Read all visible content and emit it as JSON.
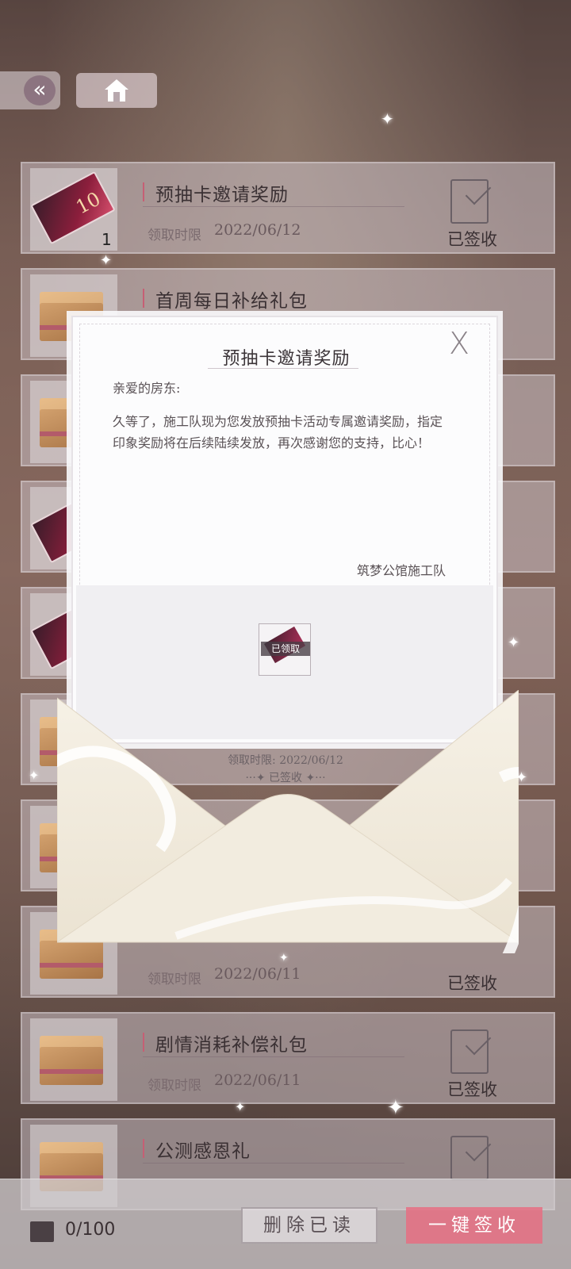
{
  "nav": {
    "back_icon": "«"
  },
  "mails": [
    {
      "title": "预抽卡邀请奖励",
      "deadline_label": "领取时限",
      "deadline": "2022/06/12",
      "status": "已签收",
      "count": "1",
      "thumb": "ticket"
    },
    {
      "title": "首周每日补给礼包",
      "deadline_label": "",
      "deadline": "",
      "status": "",
      "thumb": "box"
    },
    {
      "title": "",
      "deadline_label": "领取时限",
      "deadline": "2022/06/11",
      "status": "已签收",
      "thumb": "box"
    },
    {
      "title": "剧情消耗补偿礼包",
      "deadline_label": "领取时限",
      "deadline": "2022/06/11",
      "status": "已签收",
      "thumb": "box"
    },
    {
      "title": "公测感恩礼",
      "deadline_label": "",
      "deadline": "",
      "status": "",
      "thumb": "box"
    }
  ],
  "letter": {
    "title": "预抽卡邀请奖励",
    "close_icon": "X",
    "greeting": "亲爱的房东:",
    "body": "久等了，施工队现为您发放预抽卡活动专属邀请奖励，指定印象奖励将在后续陆续发放，再次感谢您的支持，比心！",
    "signature": "筑梦公馆施工队",
    "reward_status": "已领取",
    "deadline": "领取时限:  2022/06/12",
    "status": "···✦ 已签收 ✦···"
  },
  "bottom": {
    "inbox_count": "0/100",
    "delete_label": "删除已读",
    "sign_all_label": "一键签收"
  }
}
